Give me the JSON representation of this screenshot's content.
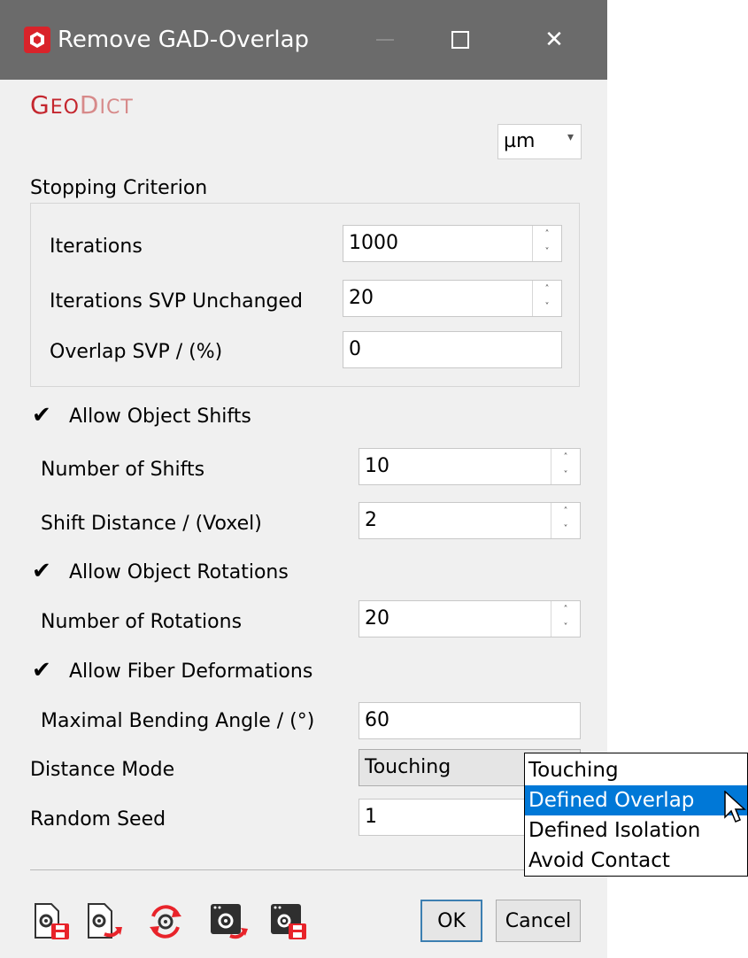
{
  "window": {
    "title": "Remove GAD-Overlap",
    "app_icon": "geodict-app-icon",
    "controls": {
      "minimize_icon": "minimize-icon",
      "maximize_icon": "maximize-icon",
      "close_glyph": "✕"
    }
  },
  "logo": {
    "big_g": "G",
    "small_eo": "EO",
    "big_d": "D",
    "small_ict": "ICT",
    "color": "#c4262e"
  },
  "unit_select": {
    "value": "µm",
    "arrow": "▾"
  },
  "stopping_criterion": {
    "label": "Stopping Criterion",
    "iterations": {
      "label": "Iterations",
      "value": "1000"
    },
    "iterations_svp_unchanged": {
      "label": "Iterations SVP Unchanged",
      "value": "20"
    },
    "overlap_svp": {
      "label": "Overlap SVP / (%)",
      "value": "0"
    }
  },
  "object_shifts": {
    "checkbox_label": "Allow Object Shifts",
    "checked": true,
    "number_of_shifts": {
      "label": "Number of Shifts",
      "value": "10"
    },
    "shift_distance": {
      "label": "Shift Distance / (Voxel)",
      "value": "2"
    }
  },
  "object_rotations": {
    "checkbox_label": "Allow Object Rotations",
    "checked": true,
    "number_of_rotations": {
      "label": "Number of Rotations",
      "value": "20"
    }
  },
  "fiber_deformations": {
    "checkbox_label": "Allow Fiber Deformations",
    "checked": true,
    "max_bending_angle": {
      "label": "Maximal Bending Angle / (°)",
      "value": "60"
    }
  },
  "distance_mode": {
    "label": "Distance Mode",
    "value": "Touching"
  },
  "random_seed": {
    "label": "Random Seed",
    "value": "1"
  },
  "check_glyph": "✔",
  "spin_up": "˄",
  "spin_down": "˅",
  "dropdown": {
    "options": [
      "Touching",
      "Defined Overlap",
      "Defined Isolation",
      "Avoid Contact"
    ],
    "selected_index": 1
  },
  "toolbar_icons": [
    "save-settings-icon",
    "load-settings-icon",
    "reset-settings-icon",
    "load-macro-icon",
    "save-macro-icon"
  ],
  "buttons": {
    "ok": "OK",
    "cancel": "Cancel"
  },
  "colors": {
    "titlebar": "#6b6b6b",
    "selection": "#0078d7",
    "logo_red": "#c4262e",
    "icon_red": "#e8232a"
  }
}
